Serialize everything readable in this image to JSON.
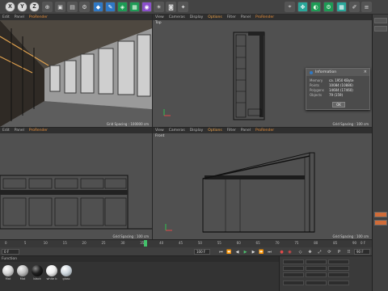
{
  "toolbar": {
    "axis_x": "X",
    "axis_y": "Y",
    "axis_z": "Z",
    "icons": [
      "x-axis-icon",
      "y-axis-icon",
      "z-axis-icon",
      "world-coords-icon",
      "render-view-icon",
      "render-region-icon",
      "render-settings-icon",
      "cube-icon",
      "pen-icon",
      "subdivision-icon",
      "array-icon",
      "deformer-icon",
      "scene-icon",
      "camera-icon",
      "light-icon",
      "snap-icon",
      "workplane-icon",
      "axis-lock-icon",
      "gear-icon"
    ]
  },
  "viewports": {
    "perspective": {
      "menu": [
        "Edit",
        "Panel",
        "ProRender"
      ],
      "grid_spacing": "Grid Spacing : 100000 cm"
    },
    "top": {
      "menu": [
        "View",
        "Cameras",
        "Display",
        "Options",
        "Filter",
        "Panel",
        "ProRender"
      ],
      "name": "Top",
      "grid_spacing": "Grid Spacing : 100 cm"
    },
    "right": {
      "menu": [
        "Edit",
        "Panel",
        "ProRender"
      ],
      "grid_spacing": "Grid Spacing : 100 cm"
    },
    "front": {
      "menu": [
        "View",
        "Cameras",
        "Display",
        "Options",
        "Filter",
        "Panel",
        "ProRender"
      ],
      "name": "Front",
      "grid_spacing": "Grid Spacing : 100 cm"
    }
  },
  "info_dialog": {
    "title": "Information",
    "rows": [
      {
        "key": "Memory",
        "value": "ca. 1950 KByte"
      },
      {
        "key": "Points",
        "value": "10084 (10886)"
      },
      {
        "key": "Polygons",
        "value": "14604 (17460)"
      },
      {
        "key": "Objects",
        "value": "79 (159)"
      }
    ],
    "ok_label": "OK"
  },
  "timeline": {
    "ticks": [
      "0",
      "5",
      "10",
      "15",
      "20",
      "25",
      "30",
      "35",
      "40",
      "45",
      "50",
      "55",
      "60",
      "65",
      "70",
      "75",
      "80",
      "85",
      "90"
    ],
    "current_frame": "0 F",
    "end_frame": "90 F",
    "start_field": "0 F",
    "end_field": "90 F",
    "fps_field": "100 F"
  },
  "materials": {
    "menu_label": "Function",
    "items": [
      {
        "name": "Mat",
        "color": "#d7d7d7"
      },
      {
        "name": "Mat",
        "color": "#bfbfbf"
      },
      {
        "name": "black",
        "color": "#1f1f1f"
      },
      {
        "name": "white b",
        "color": "#eeeeee"
      },
      {
        "name": "glass",
        "color": "#cfd8df"
      }
    ]
  },
  "colors": {
    "accent_orange": "#f3a64a",
    "playhead_green": "#43c06a",
    "selection_orange": "#d16c38"
  }
}
